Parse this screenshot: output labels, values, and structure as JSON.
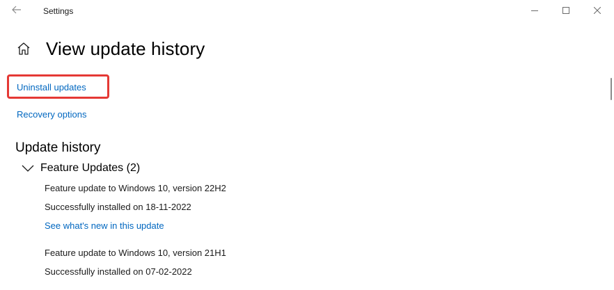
{
  "window": {
    "app_title": "Settings"
  },
  "icons": {
    "back": "back-arrow-icon",
    "minimize": "minimize-icon",
    "maximize": "maximize-icon",
    "close": "close-icon",
    "home": "home-icon",
    "chevron": "chevron-down-icon"
  },
  "colors": {
    "link": "#0067c0",
    "highlight": "#e53935"
  },
  "page": {
    "title": "View update history",
    "links": {
      "uninstall": "Uninstall updates",
      "recovery": "Recovery options"
    }
  },
  "history": {
    "title": "Update history",
    "group": {
      "title": "Feature Updates (2)",
      "items": [
        {
          "name": "Feature update to Windows 10, version 22H2",
          "status": "Successfully installed on 18-11-2022",
          "link": "See what's new in this update"
        },
        {
          "name": "Feature update to Windows 10, version 21H1",
          "status": "Successfully installed on 07-02-2022"
        }
      ]
    }
  }
}
